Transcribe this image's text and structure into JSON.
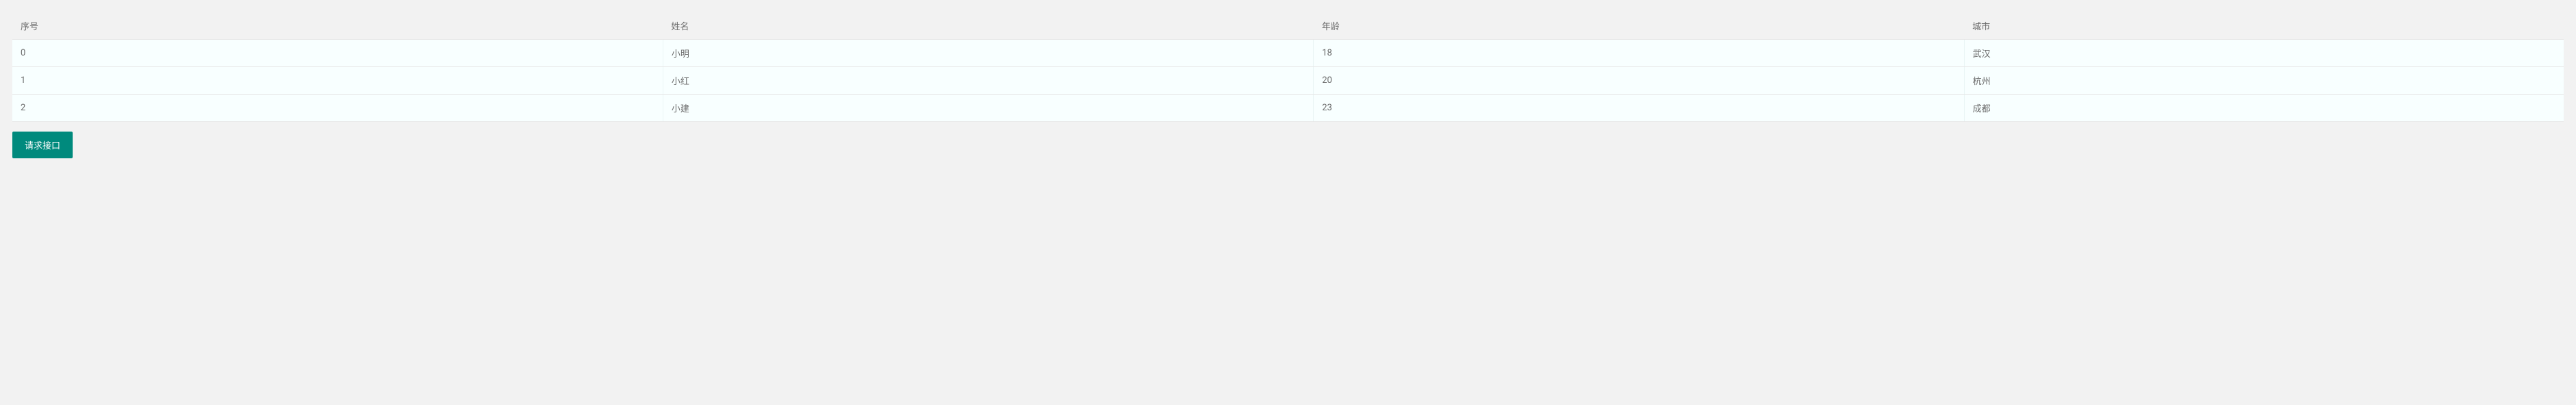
{
  "table": {
    "headers": {
      "index": "序号",
      "name": "姓名",
      "age": "年龄",
      "city": "城市"
    },
    "rows": [
      {
        "index": "0",
        "name": "小明",
        "age": "18",
        "city": "武汉"
      },
      {
        "index": "1",
        "name": "小红",
        "age": "20",
        "city": "杭州"
      },
      {
        "index": "2",
        "name": "小建",
        "age": "23",
        "city": "成都"
      }
    ]
  },
  "button": {
    "request_label": "请求接口"
  },
  "colors": {
    "page_bg": "#f2f2f2",
    "row_bg": "#f8ffff",
    "button_bg": "#008a7d",
    "text": "#6b6b6b"
  }
}
